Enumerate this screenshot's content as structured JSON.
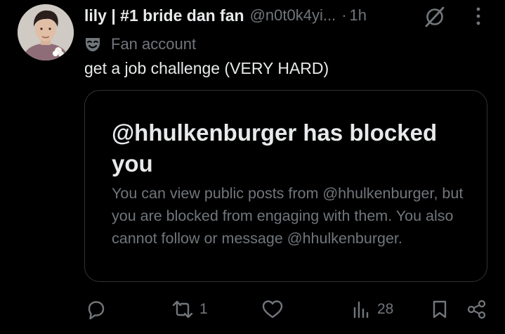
{
  "tweet": {
    "author": {
      "display_name": "lily | #1 bride dan fan",
      "handle": "@n0t0k4yi...",
      "separator": "·",
      "time": "1h",
      "avatar_icon": "avatar-photo"
    },
    "label": {
      "icon": "theater-mask-icon",
      "text": "Fan account"
    },
    "text": "get a job challenge (VERY HARD)",
    "image_card": {
      "title": "@hhulkenburger has blocked you",
      "body": "You can view public posts from @hhulkenburger, but you are blocked from engaging with them. You also cannot follow or message @hhulkenburger."
    },
    "actions": {
      "reply": {
        "icon": "reply-icon",
        "count": ""
      },
      "retweet": {
        "icon": "retweet-icon",
        "count": "1"
      },
      "like": {
        "icon": "heart-icon",
        "count": ""
      },
      "views": {
        "icon": "views-icon",
        "count": "28"
      },
      "bookmark": {
        "icon": "bookmark-icon"
      },
      "share": {
        "icon": "share-icon"
      }
    },
    "header_icons": [
      "grok-icon",
      "more-icon"
    ]
  },
  "colors": {
    "background": "#000000",
    "primary_text": "#e7e9ea",
    "secondary_text": "#71767b",
    "border": "#2f3336"
  }
}
